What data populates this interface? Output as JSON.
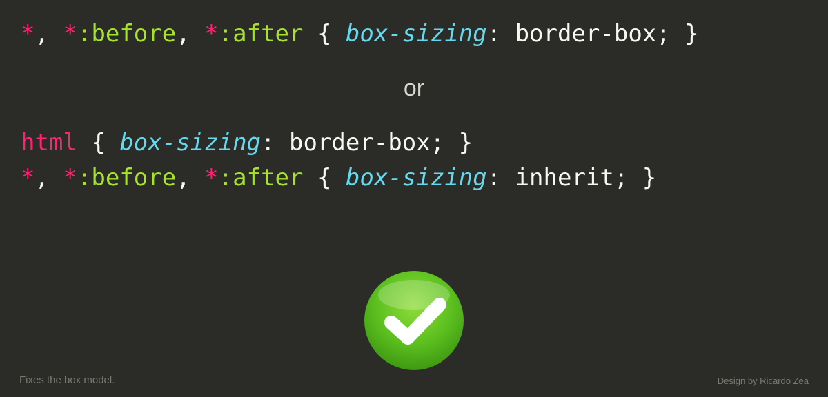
{
  "code": {
    "line1": {
      "sel_star1": "*",
      "comma1": ", ",
      "sel_star2": "*",
      "pseudo_before": ":before",
      "comma2": ", ",
      "sel_star3": "*",
      "pseudo_after": ":after",
      "space_brace_open": " { ",
      "prop": "box-sizing",
      "colon_space": ": ",
      "value": "border-box",
      "semi_brace": "; }"
    },
    "or_label": "or",
    "line2": {
      "sel_html": "html",
      "space_brace_open": " { ",
      "prop": "box-sizing",
      "colon_space": ": ",
      "value": "border-box",
      "semi_brace": "; }"
    },
    "line3": {
      "sel_star1": "*",
      "comma1": ", ",
      "sel_star2": "*",
      "pseudo_before": ":before",
      "comma2": ", ",
      "sel_star3": "*",
      "pseudo_after": ":after",
      "space_brace_open": " { ",
      "prop": "box-sizing",
      "colon_space": ": ",
      "value": "inherit",
      "semi_brace": "; }"
    }
  },
  "footer": {
    "caption": "Fixes the box model.",
    "credit": "Design by Ricardo Zea"
  }
}
